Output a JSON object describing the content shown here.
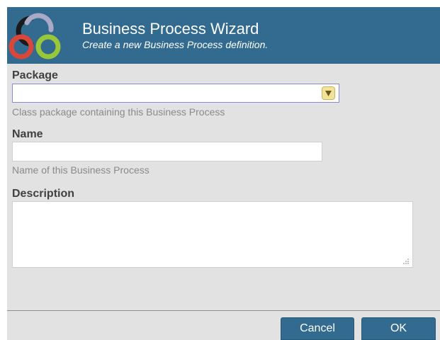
{
  "header": {
    "title": "Business Process Wizard",
    "subtitle": "Create a new Business Process definition.",
    "logo_colors": [
      "#1a1a1a",
      "#a9a9c8",
      "#d9473a",
      "#98c83a"
    ]
  },
  "form": {
    "package": {
      "label": "Package",
      "value": "",
      "hint": "Class package containing this Business Process",
      "dropdown_icon": "triangle-down-icon"
    },
    "name": {
      "label": "Name",
      "value": "",
      "placeholder": "",
      "hint": "Name of this Business Process"
    },
    "description": {
      "label": "Description",
      "value": "",
      "placeholder": ""
    }
  },
  "buttons": {
    "cancel_label": "Cancel",
    "ok_label": "OK"
  },
  "colors": {
    "header_bg": "#336a8f",
    "body_bg": "#e2e2e2",
    "button_bg": "#336a8f",
    "dropdown_button_bg": "#f2e39a",
    "select_border": "#8b89c9"
  }
}
